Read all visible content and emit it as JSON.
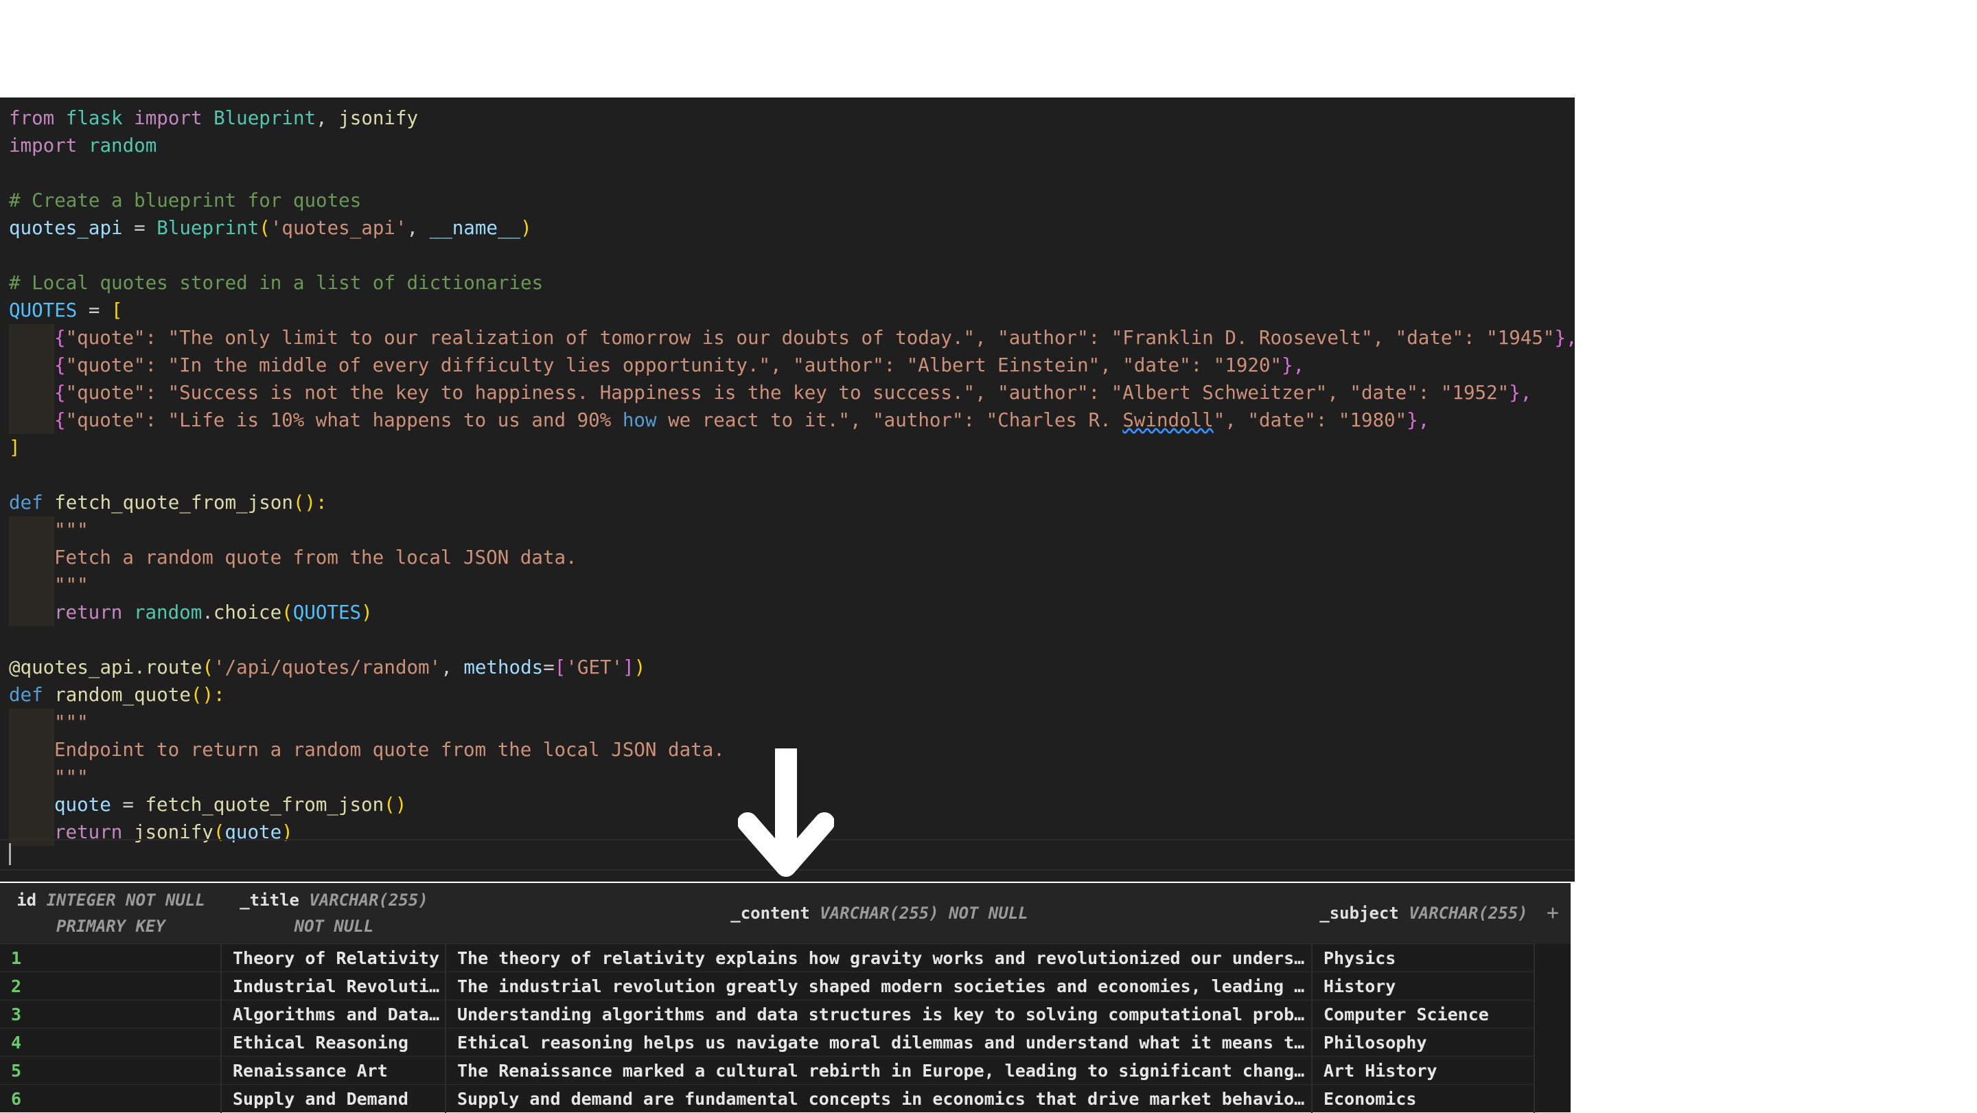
{
  "code": {
    "l1": {
      "a": "from",
      "b": "flask",
      "c": "import",
      "d": "Blueprint",
      "e": ", ",
      "f": "jsonify"
    },
    "l2": {
      "a": "import",
      "b": "random"
    },
    "l4": {
      "a": "# Create a blueprint for quotes"
    },
    "l5": {
      "a": "quotes_api",
      "b": " = ",
      "c": "Blueprint",
      "d": "(",
      "e": "'quotes_api'",
      "f": ", ",
      "g": "__name__",
      "h": ")"
    },
    "l7": {
      "a": "# Local quotes stored in a list of dictionaries"
    },
    "l8": {
      "a": "QUOTES",
      "b": " = ",
      "c": "["
    },
    "q1": {
      "a": "{",
      "b": "\"quote\": \"The only limit to our realization of tomorrow is our doubts of today.\", \"author\": \"Franklin D. Roosevelt\", \"date\": \"1945\"",
      "c": "},"
    },
    "q2": {
      "a": "{",
      "b": "\"quote\": \"In the middle of every difficulty lies opportunity.\", \"author\": \"Albert Einstein\", \"date\": \"1920\"",
      "c": "},"
    },
    "q3": {
      "a": "{",
      "b": "\"quote\": \"Success is not the key to happiness. Happiness is the key to success.\", \"author\": \"Albert Schweitzer\", \"date\": \"1952\"",
      "c": "},"
    },
    "q4": {
      "a": "{",
      "b": "\"quote\": \"Life is 10% what happens to us and 90%",
      "c": " how",
      "d": " we react to it.\", \"author\": \"Charles R. ",
      "e": "Swindoll",
      "f": "\", \"date\": \"1980\"",
      "g": "},"
    },
    "l13": {
      "a": "]"
    },
    "l15": {
      "a": "def",
      "b": "fetch_quote_from_json",
      "c": "():"
    },
    "l16": {
      "a": "\"\"\""
    },
    "l17": {
      "a": "Fetch a random quote from the local JSON data."
    },
    "l18": {
      "a": "\"\"\""
    },
    "l19": {
      "a": "return",
      "b": "random",
      "c": ".",
      "d": "choice",
      "e": "(",
      "f": "QUOTES",
      "g": ")"
    },
    "l21": {
      "a": "@quotes_api",
      "b": ".",
      "c": "route",
      "d": "(",
      "e": "'/api/quotes/random'",
      "f": ", ",
      "g": "methods",
      "h": "=",
      "i": "[",
      "j": "'GET'",
      "k": "]",
      "l": ")"
    },
    "l22": {
      "a": "def",
      "b": "random_quote",
      "c": "():"
    },
    "l23": {
      "a": "\"\"\""
    },
    "l24": {
      "a": "Endpoint to return a random quote from the local JSON data."
    },
    "l25": {
      "a": "\"\"\""
    },
    "l26": {
      "a": "quote",
      "b": " = ",
      "c": "fetch_quote_from_json",
      "d": "()"
    },
    "l27": {
      "a": "return",
      "b": "jsonify",
      "c": "(",
      "d": "quote",
      "e": ")"
    }
  },
  "table": {
    "headers": [
      {
        "name": "id",
        "type1": "INTEGER NOT NULL",
        "type2": "PRIMARY KEY"
      },
      {
        "name": "_title",
        "type1": "VARCHAR(255)",
        "type2": "NOT NULL"
      },
      {
        "name": "_content",
        "type1": "VARCHAR(255) NOT NULL",
        "type2": ""
      },
      {
        "name": "_subject",
        "type1": "VARCHAR(255)",
        "type2": ""
      }
    ],
    "add_column": "+",
    "rows": [
      {
        "id": "1",
        "title": "Theory of Relativity",
        "content": "The theory of relativity explains how gravity works and revolutionized our understand…",
        "subject": "Physics"
      },
      {
        "id": "2",
        "title": "Industrial Revoluti…",
        "content": "The industrial revolution greatly shaped modern societies and economies, leading to a…",
        "subject": "History"
      },
      {
        "id": "3",
        "title": "Algorithms and Data…",
        "content": "Understanding algorithms and data structures is key to solving computational problems…",
        "subject": "Computer Science"
      },
      {
        "id": "4",
        "title": "Ethical Reasoning",
        "content": "Ethical reasoning helps us navigate moral dilemmas and understand what it means to li…",
        "subject": "Philosophy"
      },
      {
        "id": "5",
        "title": "Renaissance Art",
        "content": "The Renaissance marked a cultural rebirth in Europe, leading to significant changes i…",
        "subject": "Art History"
      },
      {
        "id": "6",
        "title": "Supply and Demand",
        "content": "Supply and demand are fundamental concepts in economics that drive market behavior an…",
        "subject": "Economics"
      }
    ]
  }
}
